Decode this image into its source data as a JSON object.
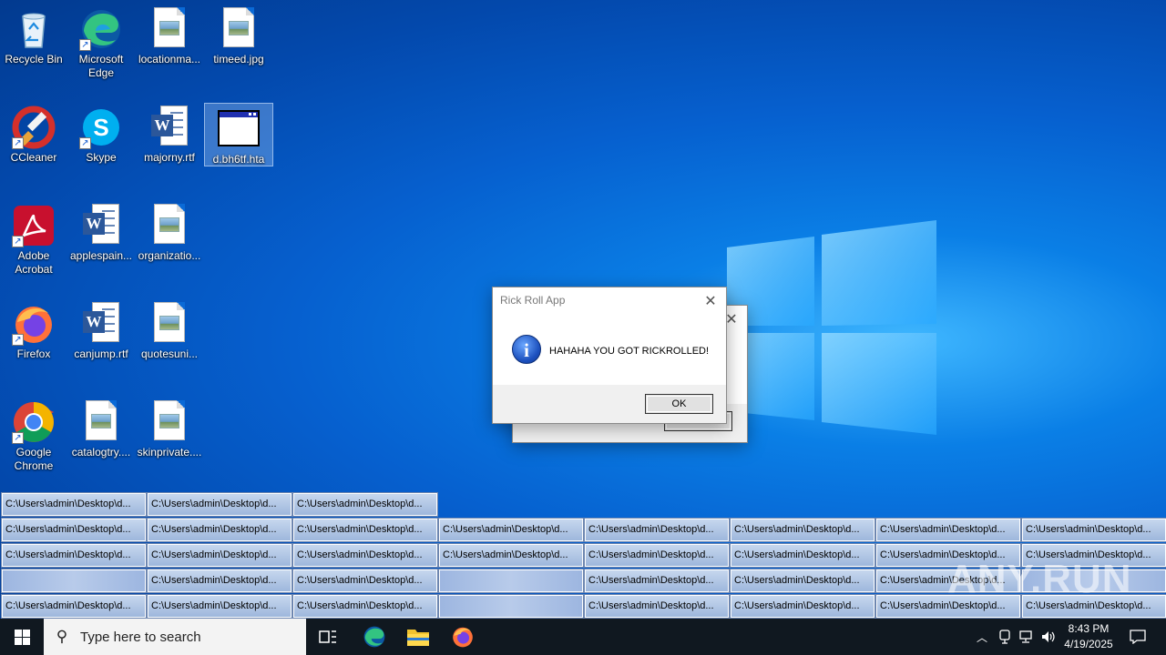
{
  "desktop": {
    "icons": [
      {
        "label": "Recycle Bin"
      },
      {
        "label": "Microsoft Edge"
      },
      {
        "label": "locationma..."
      },
      {
        "label": "timeed.jpg"
      },
      {
        "label": "CCleaner"
      },
      {
        "label": "Skype"
      },
      {
        "label": "majorny.rtf"
      },
      {
        "label": "d.bh6tf.hta"
      },
      {
        "label": "Adobe Acrobat"
      },
      {
        "label": "applespain..."
      },
      {
        "label": "organizatio..."
      },
      {
        "label": "Firefox"
      },
      {
        "label": "canjump.rtf"
      },
      {
        "label": "quotesuni..."
      },
      {
        "label": "Google Chrome"
      },
      {
        "label": "catalogtry...."
      },
      {
        "label": "skinprivate...."
      }
    ]
  },
  "dialog_back": {
    "ok_label": "OK"
  },
  "dialog": {
    "title": "Rick Roll App",
    "message": "HAHAHA YOU GOT RICKROLLED!",
    "ok_label": "OK"
  },
  "minimized_windows": {
    "label": "C:\\Users\\admin\\Desktop\\d..."
  },
  "taskbar": {
    "search_placeholder": "Type here to search",
    "time": "8:43 PM",
    "date": "4/19/2025"
  },
  "watermark": "ANY.RUN",
  "colors": {
    "desktop_bg": "#0660cf",
    "taskbar_bg": "#101820",
    "minibar_bg": "#b3c8e6"
  }
}
